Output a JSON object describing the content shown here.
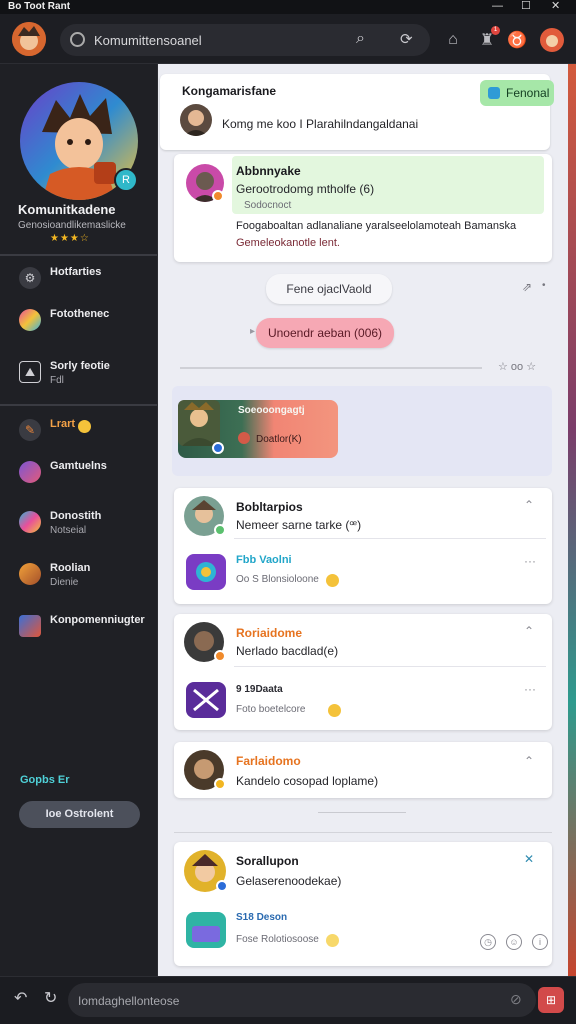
{
  "window": {
    "title": "Bo Toot Rant"
  },
  "topbar": {
    "search_text": "Komumittensoanel",
    "notification_count": "1"
  },
  "sidebar": {
    "profile": {
      "name": "Komunitkadene",
      "subtitle": "Genosioandlikemaslicke",
      "stars": "★★★☆"
    },
    "items": [
      {
        "label": "Hotfarties",
        "sub": "",
        "icon": "gear-icon"
      },
      {
        "label": "Fotothenec",
        "sub": "",
        "icon": "palette-icon"
      },
      {
        "label": "Sorly feotie",
        "sub": "Fdl",
        "icon": "photo-icon"
      },
      {
        "label": "Lrart",
        "sub": "",
        "icon": "pencil-icon"
      },
      {
        "label": "Gamtuelns",
        "sub": "",
        "icon": "group-icon"
      },
      {
        "label": "Donostith",
        "sub": "Notseial",
        "icon": "gem-icon"
      },
      {
        "label": "Roolian",
        "sub": "Dienie",
        "icon": "person-icon"
      },
      {
        "label": "Konpomenniugter",
        "sub": "",
        "icon": "community-icon"
      }
    ],
    "footer_label": "Gopbs Er",
    "footer_button": "Ioe Ostrolent"
  },
  "main": {
    "header": {
      "title": "Kongamarisfane",
      "badge": "Fenonal",
      "row_text": "Komg me koo I Plarahilndangaldanai"
    },
    "post1": {
      "title": "Abbnnyake",
      "line1": "Gerootrodomg mtholfe (6)",
      "line2": "Sodocnoct",
      "body1": "Foogaboaltan adlanaliane yaralseelolamoteah Bamanska",
      "body2": "Gemeleokanotle lent."
    },
    "pill1": "Fene ojaclVaold",
    "pill2": "Unoendr aeban (006)",
    "divider_icons": "☆ oo ☆",
    "group_card": {
      "title": "Soeooongagtj",
      "subtitle": "Doatlor(K)"
    },
    "threads": [
      {
        "title": "Bobltarpios",
        "body": "Nemeer sarne tarke (ꟹ)",
        "sub_title": "Fbb Vaolni",
        "sub_line": "Oo S Blonsioloone",
        "title_color": "dark"
      },
      {
        "title": "Roriaidome",
        "body": "Nerlado bacdlad(e)",
        "sub_title": "9 19Daata",
        "sub_line": "Foto boetelcore",
        "title_color": "orange"
      },
      {
        "title": "Farlaidomo",
        "body": "Kandelo cosopad loplame)",
        "title_color": "orange"
      },
      {
        "title": "Sorallupon",
        "body": "Gelaserenoodekae)",
        "sub_title": "S18 Deson",
        "sub_line": "Fose Rolotiosoose"
      }
    ]
  },
  "bottombar": {
    "input_text": "Iomdaghellonteose"
  }
}
